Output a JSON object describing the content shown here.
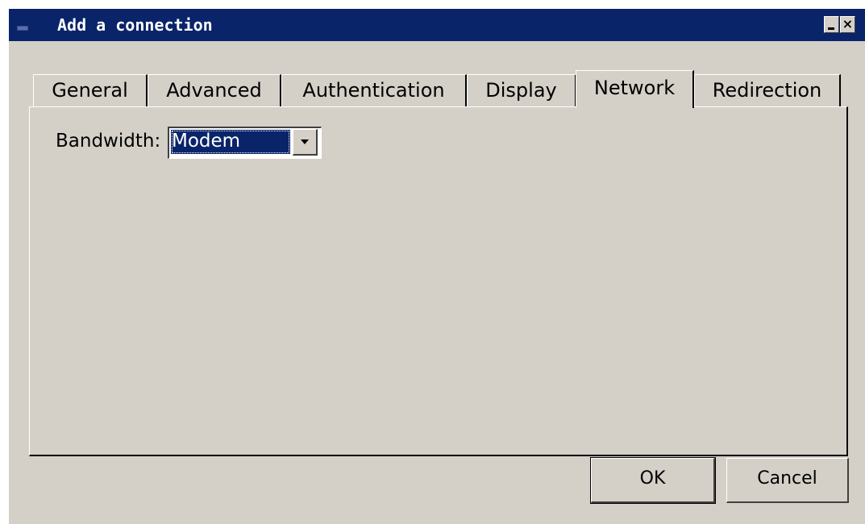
{
  "window": {
    "title": "Add a connection",
    "minimize_glyph": "",
    "close_glyph": "×"
  },
  "tabs": [
    {
      "label": "General",
      "active": false
    },
    {
      "label": "Advanced",
      "active": false
    },
    {
      "label": "Authentication",
      "active": false
    },
    {
      "label": "Display",
      "active": false
    },
    {
      "label": "Network",
      "active": true
    },
    {
      "label": "Redirection",
      "active": false
    }
  ],
  "network": {
    "bandwidth_label": "Bandwidth:",
    "bandwidth_value": "Modem"
  },
  "buttons": {
    "ok_label": "OK",
    "cancel_label": "Cancel"
  },
  "icons": {
    "window_icon": "window-icon",
    "minimize": "minimize-icon",
    "close": "close-icon",
    "dropdown": "chevron-down-icon"
  },
  "colors": {
    "titlebar": "#0a246a",
    "face": "#d4d0c8",
    "selection": "#0a246a"
  }
}
